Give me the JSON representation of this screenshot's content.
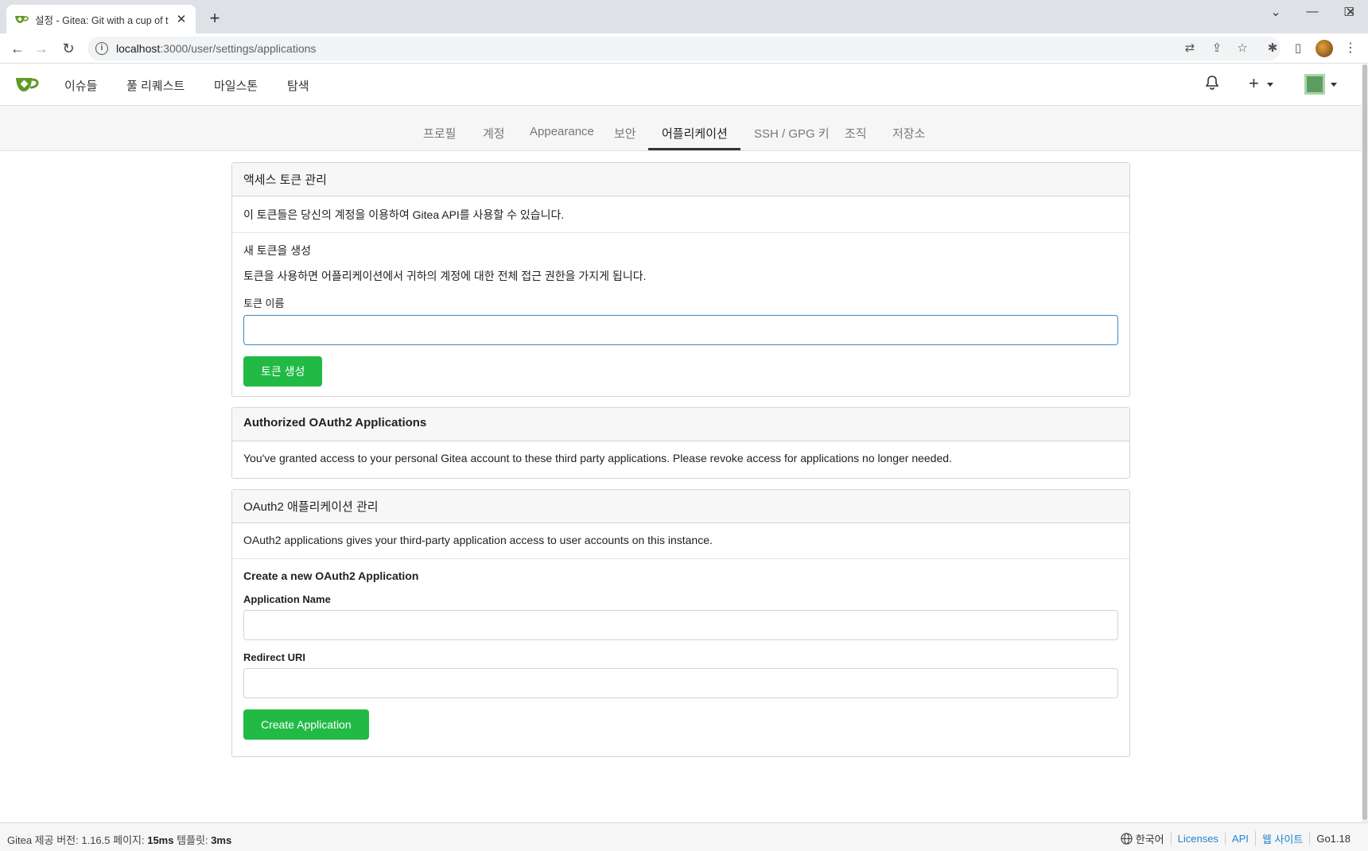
{
  "browser": {
    "tab_title": "설정 - Gitea: Git with a cup of t",
    "new_tab_symbol": "+",
    "close_symbol": "✕",
    "url_host": "localhost",
    "url_rest": ":3000/user/settings/applications"
  },
  "header": {
    "nav": [
      "이슈들",
      "풀 리퀘스트",
      "마일스톤",
      "탐색"
    ],
    "plus_symbol": "+"
  },
  "settings_tabs": {
    "items": [
      "프로필",
      "계정",
      "Appearance",
      "보안",
      "어플리케이션",
      "SSH / GPG 키",
      "조직",
      "저장소"
    ],
    "active": "어플리케이션"
  },
  "access_tokens": {
    "title": "액세스 토큰 관리",
    "description": "이 토큰들은 당신의 계정을 이용하여 Gitea API를 사용할 수 있습니다.",
    "new_title": "새 토큰을 생성",
    "warning": "토큰을 사용하면 어플리케이션에서 귀하의 계정에 대한 전체 접근 권한을 가지게 됩니다.",
    "name_label": "토큰 이름",
    "name_value": "",
    "generate_button": "토큰 생성"
  },
  "authorized_oauth": {
    "title": "Authorized OAuth2 Applications",
    "description": "You've granted access to your personal Gitea account to these third party applications. Please revoke access for applications no longer needed."
  },
  "oauth_apps": {
    "title": "OAuth2 애플리케이션 관리",
    "description": "OAuth2 applications gives your third-party application access to user accounts on this instance.",
    "create_title": "Create a new OAuth2 Application",
    "app_name_label": "Application Name",
    "app_name_value": "",
    "redirect_label": "Redirect URI",
    "redirect_value": "",
    "create_button": "Create Application"
  },
  "footer": {
    "powered": "Gitea 제공 버전: 1.16.5 페이지: ",
    "page_time": "15ms",
    "template_label": " 템플릿: ",
    "template_time": "3ms",
    "language": "한국어",
    "links": [
      "Licenses",
      "API",
      "웹 사이트"
    ],
    "go_version": "Go1.18"
  },
  "colors": {
    "primary_green": "#21ba45",
    "link_blue": "#2185d0",
    "focus_border": "#3a8ac9"
  }
}
